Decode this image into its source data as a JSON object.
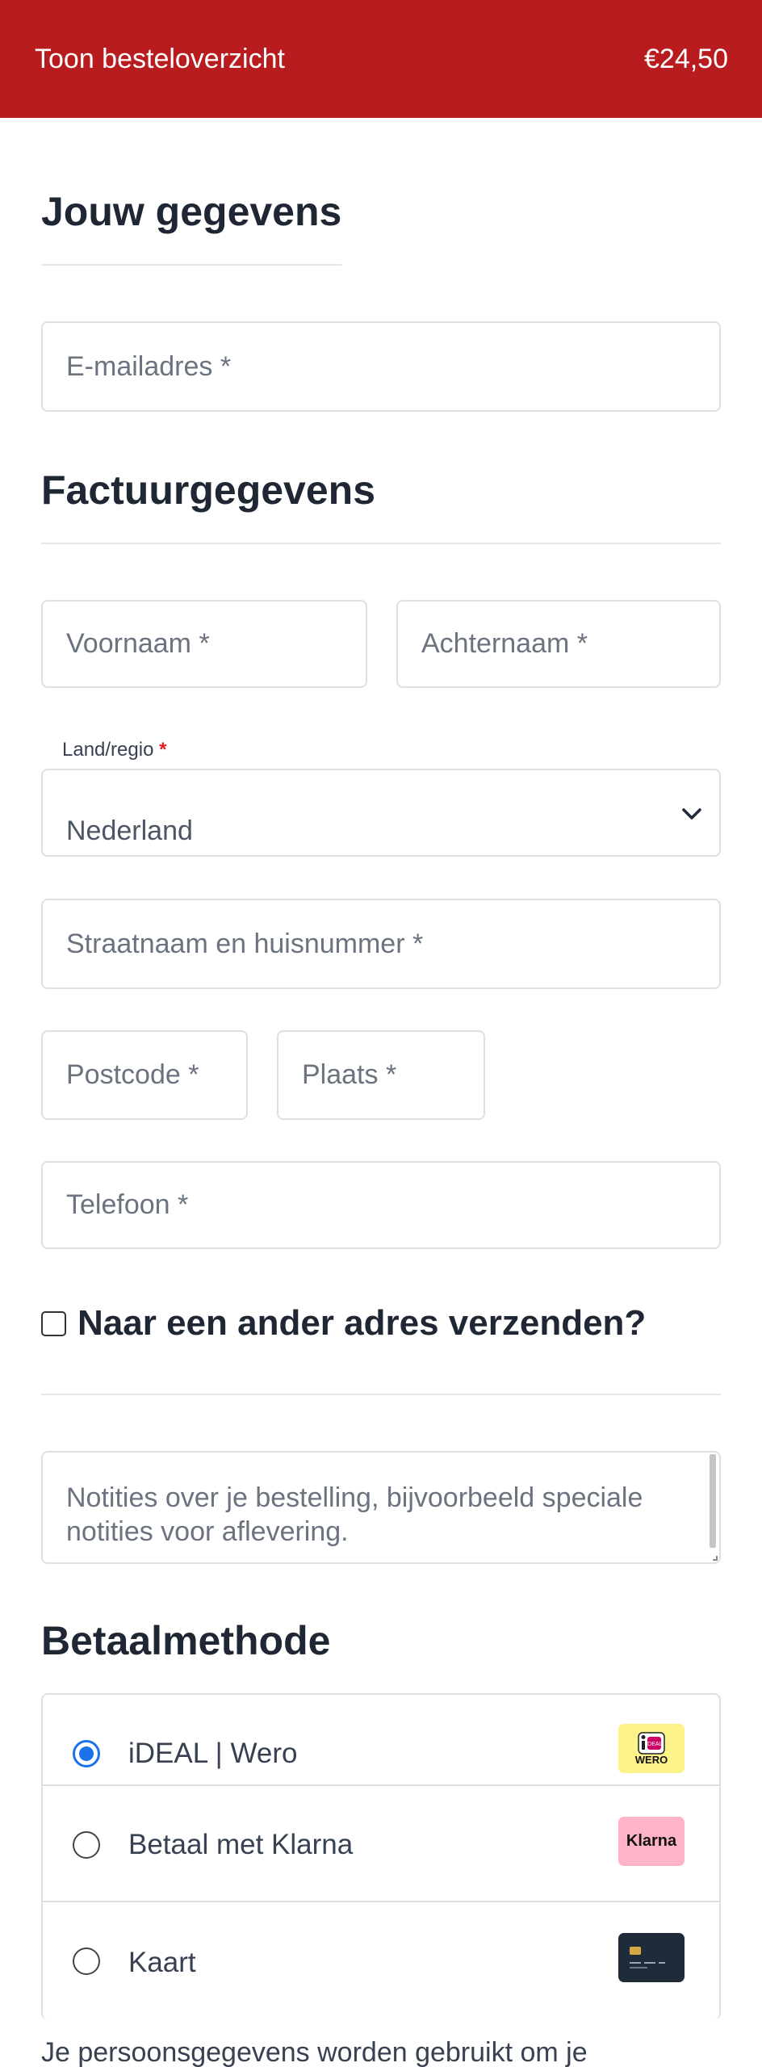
{
  "header": {
    "order_summary_label": "Toon besteloverzicht",
    "total": "€24,50",
    "background": "#b81c1f"
  },
  "your_details": {
    "heading": "Jouw gegevens",
    "email_placeholder": "E-mailadres *"
  },
  "billing": {
    "heading": "Factuurgegevens",
    "first_name_placeholder": "Voornaam *",
    "last_name_placeholder": "Achternaam *",
    "country_label": "Land/regio",
    "country_required": "*",
    "country_value": "Nederland",
    "street_placeholder": "Straatnaam en huisnummer *",
    "postcode_placeholder": "Postcode *",
    "city_placeholder": "Plaats *",
    "phone_placeholder": "Telefoon *"
  },
  "shipping": {
    "other_address_label": "Naar een ander adres verzenden?",
    "checked": false
  },
  "notes": {
    "placeholder": "Notities over je bestelling, bijvoorbeeld speciale notities voor aflevering."
  },
  "payment": {
    "heading": "Betaalmethode",
    "methods": [
      {
        "label": "iDEAL | Wero",
        "selected": true,
        "icon": "ideal-wero-logo",
        "logo_wordmark": "WERO"
      },
      {
        "label": "Betaal met Klarna",
        "selected": false,
        "icon": "klarna-logo",
        "logo_wordmark": "Klarna"
      },
      {
        "label": "Kaart",
        "selected": false,
        "icon": "card-icon"
      }
    ],
    "selected_color": "#1a73e8"
  },
  "privacy": {
    "text": "Je persoonsgegevens worden gebruikt om je"
  }
}
